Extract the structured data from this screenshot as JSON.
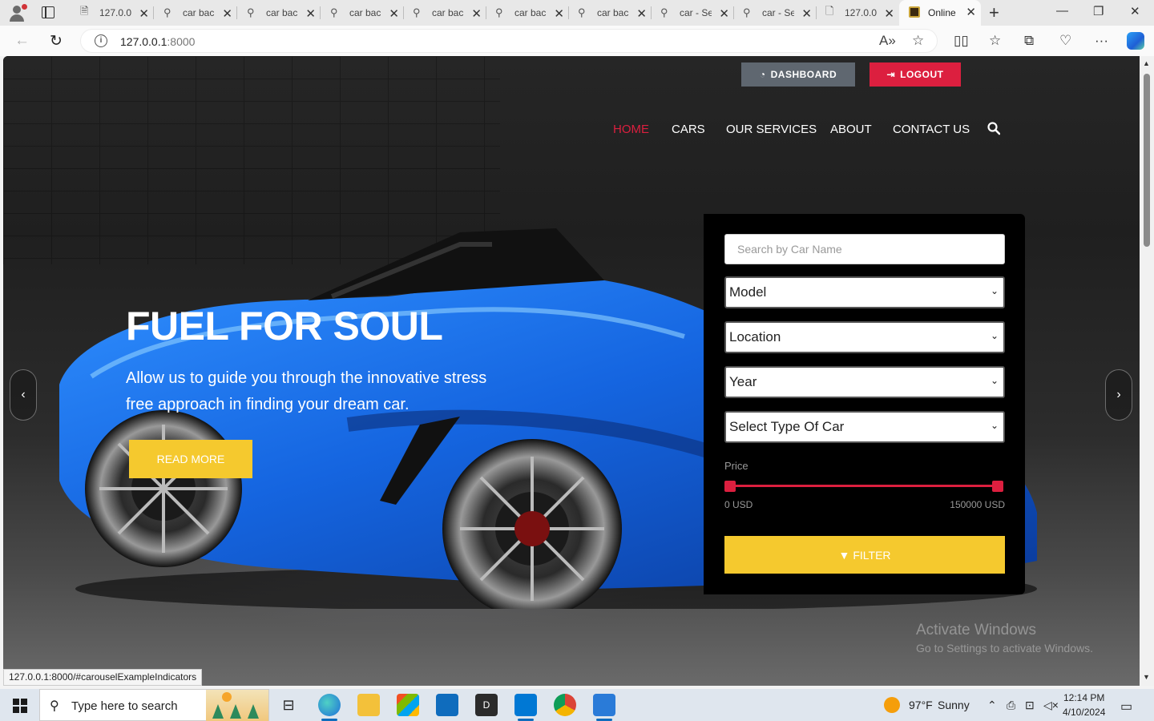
{
  "browser": {
    "tabs": [
      {
        "title": "127.0.0",
        "icon": "file-lock-icon"
      },
      {
        "title": "car bac",
        "icon": "search-icon"
      },
      {
        "title": "car bac",
        "icon": "search-icon"
      },
      {
        "title": "car bac",
        "icon": "search-icon"
      },
      {
        "title": "car bac",
        "icon": "search-icon"
      },
      {
        "title": "car bac",
        "icon": "search-icon"
      },
      {
        "title": "car bac",
        "icon": "search-icon"
      },
      {
        "title": "car - Se",
        "icon": "search-icon"
      },
      {
        "title": "car - Se",
        "icon": "search-icon"
      },
      {
        "title": "127.0.0",
        "icon": "page-icon"
      },
      {
        "title": "Online",
        "icon": "site-favicon"
      }
    ],
    "url_host": "127.0.0.1",
    "url_port": ":8000",
    "status_url": "127.0.0.1:8000/#carouselExampleIndicators"
  },
  "site": {
    "header": {
      "dashboard_label": "DASHBOARD",
      "logout_label": "LOGOUT"
    },
    "nav": {
      "items": [
        {
          "label": "HOME",
          "active": true
        },
        {
          "label": "CARS",
          "active": false
        },
        {
          "label": "OUR SERVICES",
          "active": false
        },
        {
          "label": "ABOUT",
          "active": false
        },
        {
          "label": "CONTACT US",
          "active": false
        }
      ]
    },
    "hero": {
      "title": "FUEL FOR SOUL",
      "text": "Allow us to guide you through the innovative stress free approach in finding your dream car.",
      "button_label": "READ MORE"
    },
    "filter": {
      "search_placeholder": "Search by Car Name",
      "model_selected": "Model",
      "location_selected": "Location",
      "year_selected": "Year",
      "type_selected": "Select Type Of Car",
      "price_label": "Price",
      "price_min_label": "0 USD",
      "price_max_label": "150000 USD",
      "price_range": {
        "min": 0,
        "max": 150000,
        "low": 0,
        "high": 150000
      },
      "button_label": "FILTER"
    },
    "watermark": {
      "title": "Activate Windows",
      "subtitle": "Go to Settings to activate Windows."
    }
  },
  "taskbar": {
    "search_placeholder": "Type here to search",
    "weather_temp": "97°F",
    "weather_desc": "Sunny",
    "time": "12:14 PM",
    "date": "4/10/2024"
  },
  "colors": {
    "accent_red": "#dc1f3f",
    "accent_yellow": "#f5c92e",
    "dashboard_gray": "#5f6770"
  }
}
